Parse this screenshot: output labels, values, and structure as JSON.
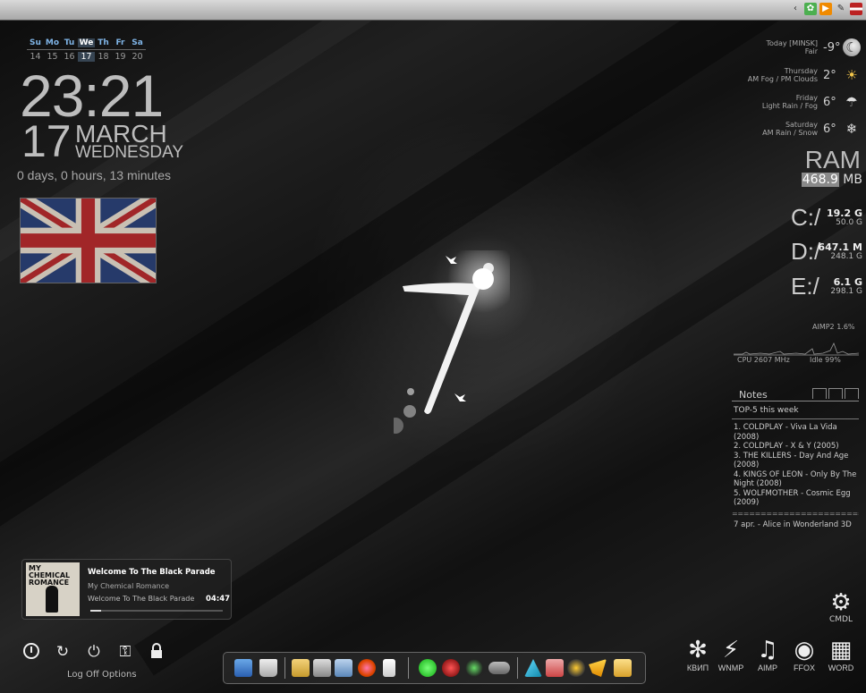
{
  "tray": {
    "icons": [
      "arrow-left-icon",
      "green-gear-icon",
      "media-icon",
      "pencil-icon",
      "us-flag-icon"
    ]
  },
  "calendar": {
    "weekdays": [
      "Su",
      "Mo",
      "Tu",
      "We",
      "Th",
      "Fr",
      "Sa"
    ],
    "days": [
      "14",
      "15",
      "16",
      "17",
      "18",
      "19",
      "20"
    ],
    "today_index": 3
  },
  "clock": {
    "time": "23:21",
    "day": "17",
    "month": "MARCH",
    "weekday": "WEDNESDAY"
  },
  "uptime": "0 days, 0 hours, 13 minutes",
  "weather": [
    {
      "line1": "Today [MINSK]",
      "line2": "Fair",
      "temp": "-9°",
      "icon": "moon-icon"
    },
    {
      "line1": "Thursday",
      "line2": "AM Fog / PM Clouds",
      "temp": "2°",
      "icon": "sun-icon"
    },
    {
      "line1": "Friday",
      "line2": "Light Rain / Fog",
      "temp": "6°",
      "icon": "rain-icon"
    },
    {
      "line1": "Saturday",
      "line2": "AM Rain / Snow",
      "temp": "6°",
      "icon": "snow-rain-icon"
    }
  ],
  "ram": {
    "label": "RAM",
    "value_highlight": "468.9",
    "value_unit": " MB"
  },
  "drives": [
    {
      "letter": "C:/",
      "used": "19.2 G",
      "total": "50.0 G"
    },
    {
      "letter": "D:/",
      "used": "647.1 M",
      "total": "248.1 G"
    },
    {
      "letter": "E:/",
      "used": "6.1 G",
      "total": "298.1 G"
    }
  ],
  "cpu": {
    "aimp": "AIMP2 1.6%",
    "freq": "CPU 2607 MHz",
    "idle": "Idle 99%"
  },
  "notes": {
    "title": "Notes",
    "heading": "TOP-5 this week",
    "lines": [
      "1. COLDPLAY - Viva La Vida",
      "(2008)",
      "2. COLDPLAY - X & Y (2005)",
      "3. THE KILLERS - Day And Age",
      "(2008)",
      "4. KINGS OF LEON - Only By The",
      "Night (2008)",
      "5. WOLFMOTHER - Cosmic Egg",
      "(2009)"
    ],
    "separator": "==========================",
    "footer": "7 apr. - Alice in Wonderland 3D"
  },
  "player": {
    "title": "Welcome To The Black Parade",
    "artist": "My Chemical Romance",
    "album": "Welcome To The Black Parade",
    "time": "04:47",
    "album_art_text": "MY CHEMICAL ROMANCE",
    "progress": 0.08
  },
  "power": {
    "label": "Log Off Options",
    "buttons": [
      "shutdown-icon",
      "restart-icon",
      "power-icon",
      "key-icon",
      "lock-icon"
    ]
  },
  "launchers": [
    {
      "label": "КВИП",
      "icon": "flower-icon",
      "glyph": "✻"
    },
    {
      "label": "WNMP",
      "icon": "lightning-icon",
      "glyph": "⚡"
    },
    {
      "label": "AIMP",
      "icon": "music-note-icon",
      "glyph": "♫"
    },
    {
      "label": "FFOX",
      "icon": "firefox-icon",
      "glyph": "◉"
    },
    {
      "label": "WORD",
      "icon": "word-icon",
      "glyph": "▦"
    }
  ],
  "cmdl": {
    "label": "CMDL",
    "icon": "gear-icon",
    "glyph": "⚙"
  },
  "colors": {
    "accent": "#7fb4e6",
    "text": "#d8d8d8",
    "background": "#141414"
  }
}
